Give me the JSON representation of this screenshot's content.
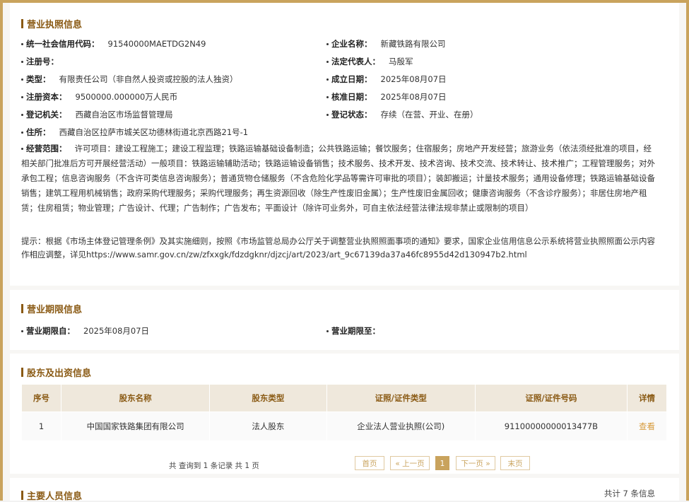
{
  "license": {
    "title": "营业执照信息",
    "fields": [
      {
        "label": "统一社会信用代码：",
        "value": "91540000MAETDG2N49"
      },
      {
        "label": "企业名称：",
        "value": "新藏铁路有限公司"
      },
      {
        "label": "注册号：",
        "value": ""
      },
      {
        "label": "法定代表人：",
        "value": "马殷军"
      },
      {
        "label": "类型：",
        "value": "有限责任公司（非自然人投资或控股的法人独资）"
      },
      {
        "label": "成立日期：",
        "value": "2025年08月07日"
      },
      {
        "label": "注册资本：",
        "value": "9500000.000000万人民币"
      },
      {
        "label": "核准日期：",
        "value": "2025年08月07日"
      },
      {
        "label": "登记机关：",
        "value": "西藏自治区市场监督管理局"
      },
      {
        "label": "登记状态：",
        "value": "存续（在营、开业、在册）"
      },
      {
        "label": "住所：",
        "value": "西藏自治区拉萨市城关区功德林街道北京西路21号-1"
      }
    ],
    "scope_label": "经营范围：",
    "scope_text": "许可项目：建设工程施工；建设工程监理；铁路运输基础设备制造；公共铁路运输；餐饮服务；住宿服务；房地产开发经营；旅游业务（依法须经批准的项目，经相关部门批准后方可开展经营活动）一般项目：铁路运输辅助活动；铁路运输设备销售；技术服务、技术开发、技术咨询、技术交流、技术转让、技术推广；工程管理服务；对外承包工程；信息咨询服务（不含许可类信息咨询服务）；普通货物仓储服务（不含危险化学品等需许可审批的项目）；装卸搬运；计量技术服务；通用设备修理；铁路运输基础设备销售；建筑工程用机械销售；政府采购代理服务；采购代理服务；再生资源回收（除生产性废旧金属）；生产性废旧金属回收；健康咨询服务（不含诊疗服务）；非居住房地产租赁；住房租赁；物业管理；广告设计、代理；广告制作；广告发布；平面设计（除许可业务外，可自主依法经营法律法规非禁止或限制的项目）",
    "note": "提示：根据《市场主体登记管理条例》及其实施细则，按照《市场监管总局办公厅关于调整营业执照照面事项的通知》要求，国家企业信用信息公示系统将营业执照照面公示内容作相应调整，详见https://www.samr.gov.cn/zw/zfxxgk/fdzdgknr/djzcj/art/2023/art_9c67139da37a46fc8955d42d130947b2.html"
  },
  "term": {
    "title": "营业期限信息",
    "from_label": "营业期限自：",
    "from_value": "2025年08月07日",
    "to_label": "营业期限至：",
    "to_value": ""
  },
  "shareholders": {
    "title": "股东及出资信息",
    "columns": [
      "序号",
      "股东名称",
      "股东类型",
      "证照/证件类型",
      "证照/证件号码",
      "详情"
    ],
    "rows": [
      {
        "no": "1",
        "name": "中国国家铁路集团有限公司",
        "type": "法人股东",
        "cert_type": "企业法人营业执照(公司)",
        "cert_no": "91100000000013477B",
        "detail": "查看"
      }
    ],
    "pager": {
      "info": "共 查询到 1 条记录 共 1 页",
      "first": "首页",
      "prev": "« 上一页",
      "current": "1",
      "next": "下一页 »",
      "last": "末页"
    }
  },
  "personnel": {
    "title": "主要人员信息",
    "total": "共计 7 条信息"
  },
  "colors": {
    "accent": "#c9a35d",
    "title_brown": "#8a5a14",
    "link": "#d79b3c"
  }
}
